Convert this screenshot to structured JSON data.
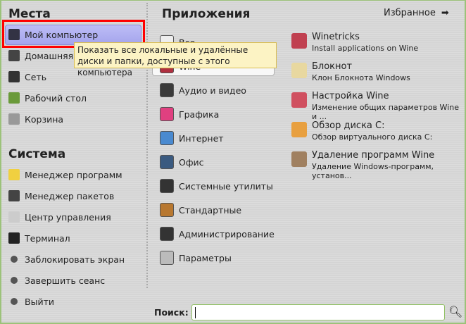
{
  "places": {
    "title": "Места",
    "items": [
      {
        "label": "Мой компьютер",
        "icon": "computer-icon",
        "color": "#334"
      },
      {
        "label": "Домашняя папка",
        "icon": "home-icon",
        "color": "#444"
      },
      {
        "label": "Сеть",
        "icon": "network-icon",
        "color": "#333"
      },
      {
        "label": "Рабочий стол",
        "icon": "desktop-icon",
        "color": "#6a9a3a"
      },
      {
        "label": "Корзина",
        "icon": "trash-icon",
        "color": "#999"
      }
    ]
  },
  "system": {
    "title": "Система",
    "items": [
      {
        "label": "Менеджер программ",
        "icon": "software-manager-icon",
        "color": "#f0d040"
      },
      {
        "label": "Менеджер пакетов",
        "icon": "package-manager-icon",
        "color": "#444"
      },
      {
        "label": "Центр управления",
        "icon": "control-center-icon",
        "color": "#ccc"
      },
      {
        "label": "Терминал",
        "icon": "terminal-icon",
        "color": "#222"
      },
      {
        "label": "Заблокировать экран",
        "icon": "lock-icon",
        "color": "#555"
      },
      {
        "label": "Завершить сеанс",
        "icon": "logout-icon",
        "color": "#555"
      },
      {
        "label": "Выйти",
        "icon": "power-icon",
        "color": "#555"
      }
    ]
  },
  "apps": {
    "title": "Приложения",
    "favorites_label": "Избранное",
    "categories": [
      {
        "label": "Все",
        "icon": "all-icon",
        "color": "#eee"
      },
      {
        "label": "Wine",
        "icon": "wine-icon",
        "color": "#b03040"
      },
      {
        "label": "Аудио и видео",
        "icon": "multimedia-icon",
        "color": "#3a3a3a"
      },
      {
        "label": "Графика",
        "icon": "graphics-icon",
        "color": "#e04080"
      },
      {
        "label": "Интернет",
        "icon": "internet-icon",
        "color": "#4a8ad0"
      },
      {
        "label": "Офис",
        "icon": "office-icon",
        "color": "#3a5a80"
      },
      {
        "label": "Системные утилиты",
        "icon": "system-tools-icon",
        "color": "#333"
      },
      {
        "label": "Стандартные",
        "icon": "accessories-icon",
        "color": "#b87830"
      },
      {
        "label": "Администрирование",
        "icon": "administration-icon",
        "color": "#333"
      },
      {
        "label": "Параметры",
        "icon": "preferences-icon",
        "color": "#bbb"
      }
    ],
    "entries": [
      {
        "title": "Winetricks",
        "subtitle": "Install applications on Wine",
        "icon": "winetricks-icon",
        "color": "#c04050"
      },
      {
        "title": "Блокнот",
        "subtitle": "Клон Блокнота Windows",
        "icon": "notepad-icon",
        "color": "#e8d8a0"
      },
      {
        "title": "Настройка Wine",
        "subtitle": "Изменение общих параметров Wine и ...",
        "icon": "wine-config-icon",
        "color": "#d05060"
      },
      {
        "title": "Обзор диска C:",
        "subtitle": "Обзор виртуального диска C:",
        "icon": "browse-c-drive-icon",
        "color": "#e8a040"
      },
      {
        "title": "Удаление программ Wine",
        "subtitle": "Удаление Windows-программ, установ...",
        "icon": "uninstall-wine-icon",
        "color": "#a08060"
      }
    ]
  },
  "tooltip": "Показать все локальные и удалённые диски и папки, доступные с этого компьютера",
  "search": {
    "label": "Поиск:",
    "value": ""
  }
}
